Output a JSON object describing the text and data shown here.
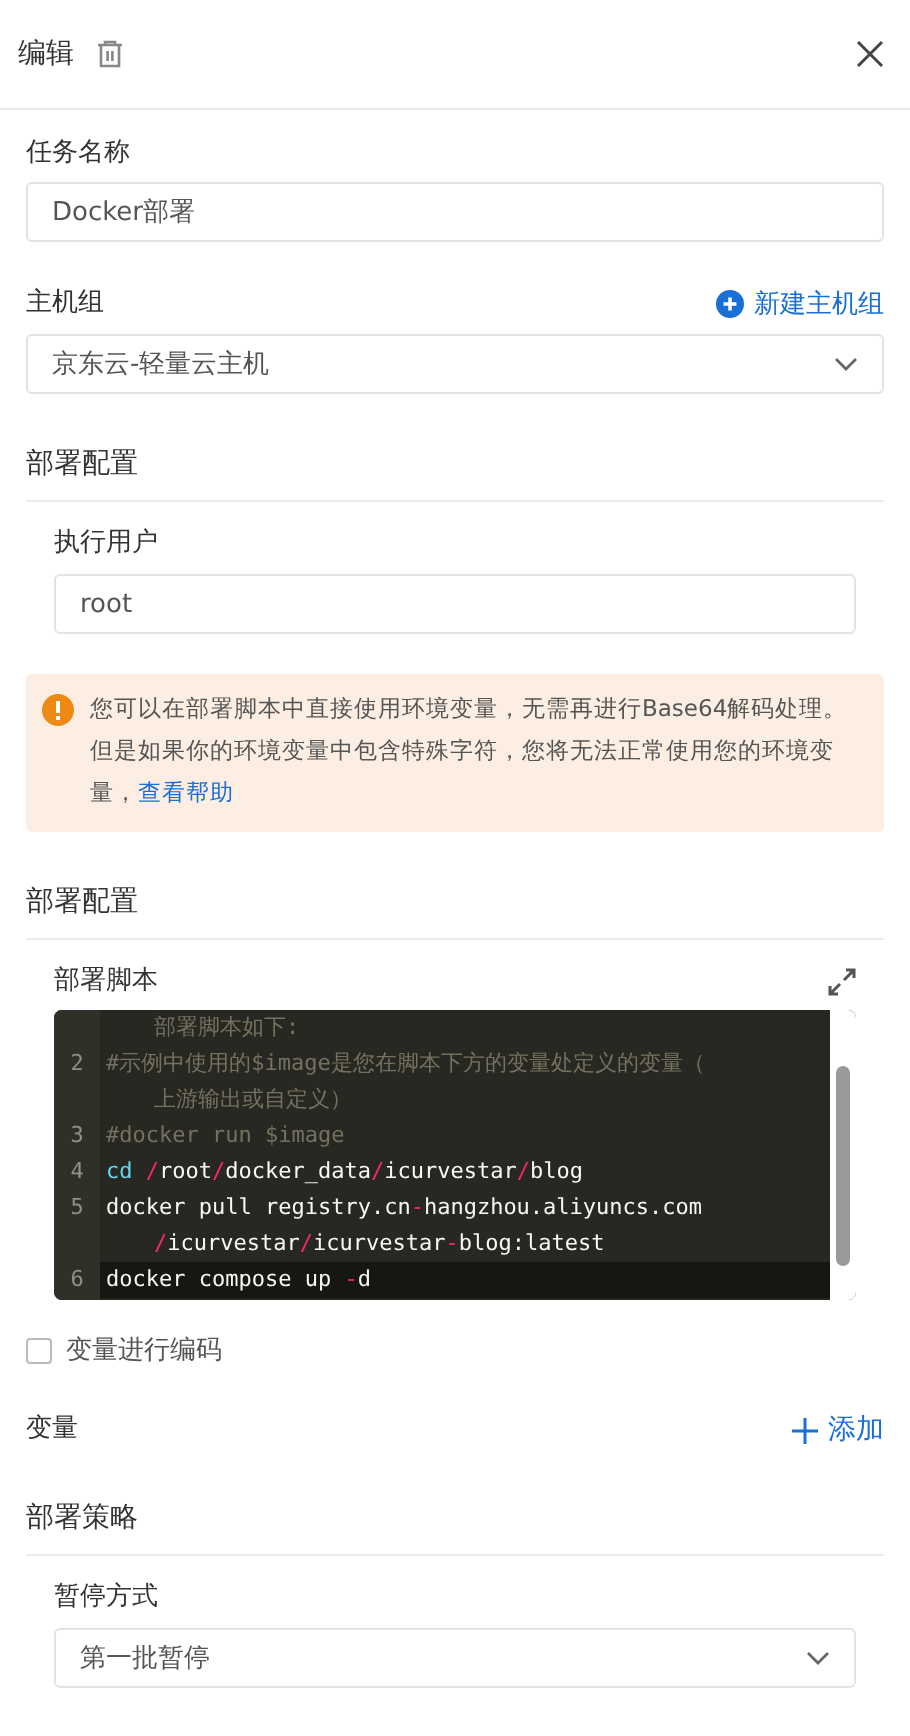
{
  "header": {
    "title": "编辑"
  },
  "task_name": {
    "label": "任务名称",
    "value": "Docker部署"
  },
  "host_group": {
    "label": "主机组",
    "action": "新建主机组",
    "value": "京东云-轻量云主机"
  },
  "deploy_config": {
    "title": "部署配置",
    "user_label": "执行用户",
    "user_value": "root"
  },
  "alert": {
    "text": "您可以在部署脚本中直接使用环境变量，无需再进行Base64解码处理。但是如果你的环境变量中包含特殊字符，您将无法正常使用您的环境变量，",
    "link": "查看帮助"
  },
  "script_section": {
    "title": "部署配置",
    "label": "部署脚本",
    "rows": [
      {
        "wrapped": true,
        "active": false,
        "segments": [
          {
            "text": "部署脚本如下:",
            "kind": "comment"
          }
        ]
      },
      {
        "number": "2",
        "wrapped": false,
        "active": false,
        "segments": [
          {
            "text": "#示例中使用的$image是您在脚本下方的变量处定义的变量（",
            "kind": "comment"
          }
        ]
      },
      {
        "wrapped": true,
        "active": false,
        "segments": [
          {
            "text": "上游输出或自定义）",
            "kind": "comment"
          }
        ]
      },
      {
        "number": "3",
        "wrapped": false,
        "active": false,
        "segments": [
          {
            "text": "#docker run $image",
            "kind": "comment"
          }
        ]
      },
      {
        "number": "4",
        "wrapped": false,
        "active": false,
        "segments": [
          {
            "text": "cd ",
            "kind": "keyword"
          },
          {
            "text": "/",
            "kind": "operator"
          },
          {
            "text": "root",
            "kind": "plain"
          },
          {
            "text": "/",
            "kind": "operator"
          },
          {
            "text": "docker_data",
            "kind": "plain"
          },
          {
            "text": "/",
            "kind": "operator"
          },
          {
            "text": "icurvestar",
            "kind": "plain"
          },
          {
            "text": "/",
            "kind": "operator"
          },
          {
            "text": "blog",
            "kind": "plain"
          }
        ]
      },
      {
        "number": "5",
        "wrapped": false,
        "active": false,
        "segments": [
          {
            "text": "docker pull registry.cn",
            "kind": "plain"
          },
          {
            "text": "-",
            "kind": "operator"
          },
          {
            "text": "hangzhou.aliyuncs.com",
            "kind": "plain"
          }
        ]
      },
      {
        "wrapped": true,
        "active": false,
        "segments": [
          {
            "text": "/",
            "kind": "operator"
          },
          {
            "text": "icurvestar",
            "kind": "plain"
          },
          {
            "text": "/",
            "kind": "operator"
          },
          {
            "text": "icurvestar",
            "kind": "plain"
          },
          {
            "text": "-",
            "kind": "operator"
          },
          {
            "text": "blog:latest",
            "kind": "plain"
          }
        ]
      },
      {
        "number": "6",
        "wrapped": false,
        "active": true,
        "segments": [
          {
            "text": "docker compose up ",
            "kind": "plain"
          },
          {
            "text": "-",
            "kind": "operator"
          },
          {
            "text": "d",
            "kind": "plain"
          }
        ]
      }
    ]
  },
  "encode": {
    "label": "变量进行编码",
    "checked": false
  },
  "variables": {
    "label": "变量",
    "action": "添加"
  },
  "strategy": {
    "title": "部署策略",
    "pause_label": "暂停方式",
    "pause_value": "第一批暂停"
  }
}
